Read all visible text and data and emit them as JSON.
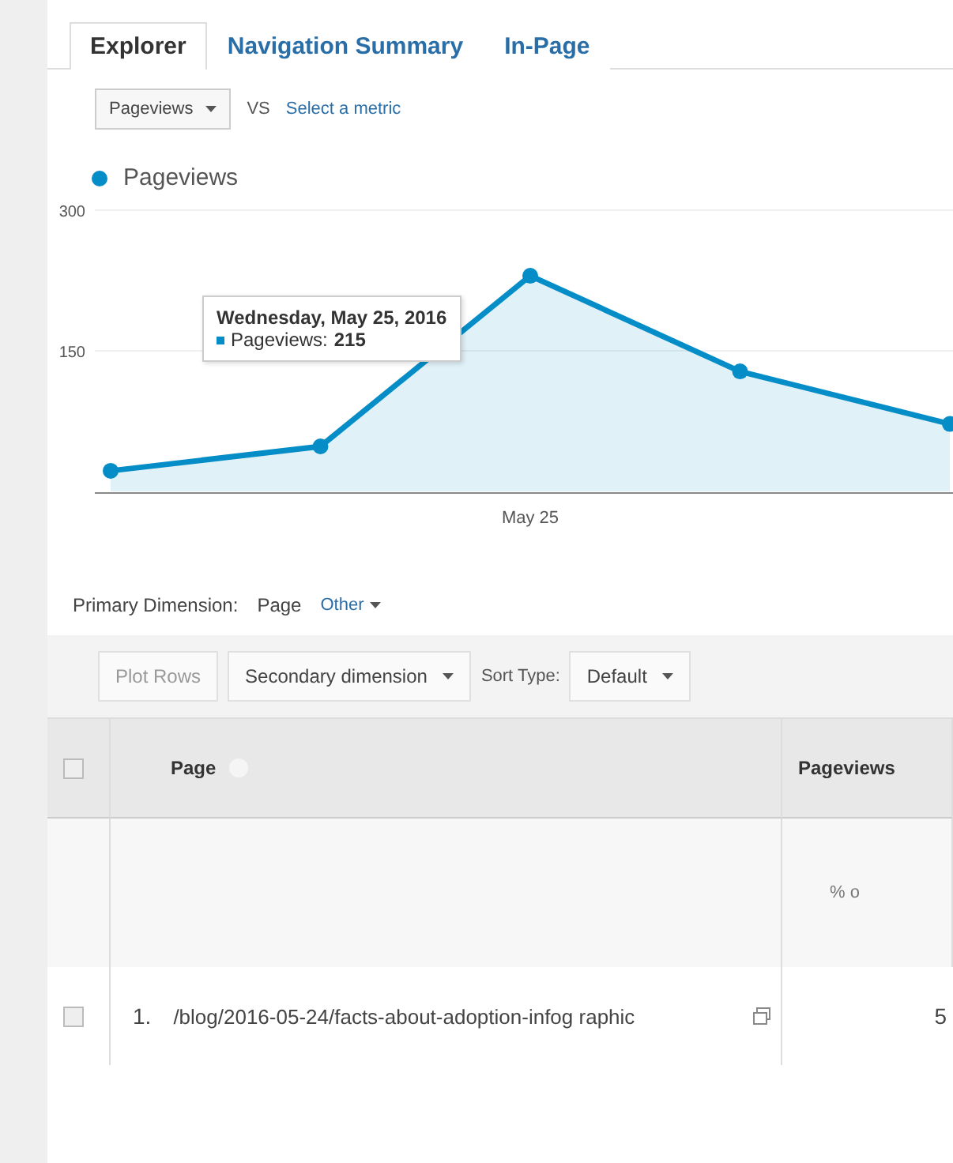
{
  "tabs": [
    {
      "label": "Explorer",
      "selected": true
    },
    {
      "label": "Navigation Summary",
      "selected": false
    },
    {
      "label": "In-Page",
      "selected": false
    }
  ],
  "metric_bar": {
    "metric": "Pageviews",
    "vs": "VS",
    "compare_link": "Select a metric"
  },
  "chart": {
    "tooltip": {
      "title": "Wednesday, May 25, 2016",
      "series": "Pageviews:",
      "value": "215"
    },
    "chart_data": {
      "type": "area",
      "categories": [
        null,
        null,
        "May 25",
        null,
        null
      ],
      "series": [
        {
          "name": "Pageviews",
          "color": "#058dc7",
          "values": [
            22,
            48,
            230,
            128,
            72
          ]
        }
      ],
      "ylim": [
        0,
        300
      ],
      "yticks": [
        {
          "value": 150,
          "label": "150"
        },
        {
          "value": 300,
          "label": "300"
        }
      ]
    }
  },
  "primary_dimension": {
    "label": "Primary Dimension:",
    "selected": "Page",
    "other": "Other"
  },
  "toolbar": {
    "plot_rows": {
      "label": "Plot Rows",
      "disabled": true
    },
    "secondary": "Secondary dimension",
    "sort_label": "Sort Type:",
    "sort_value": "Default"
  },
  "table": {
    "all_checked": false,
    "columns": [
      "Page",
      "Pageviews"
    ],
    "totals": {
      "column_2": "% o"
    },
    "rows": [
      {
        "index": "1.",
        "page": "/blog/2016-05-24/facts-about-adoption-infog raphic",
        "pageviews": "5",
        "checked": false
      }
    ]
  }
}
